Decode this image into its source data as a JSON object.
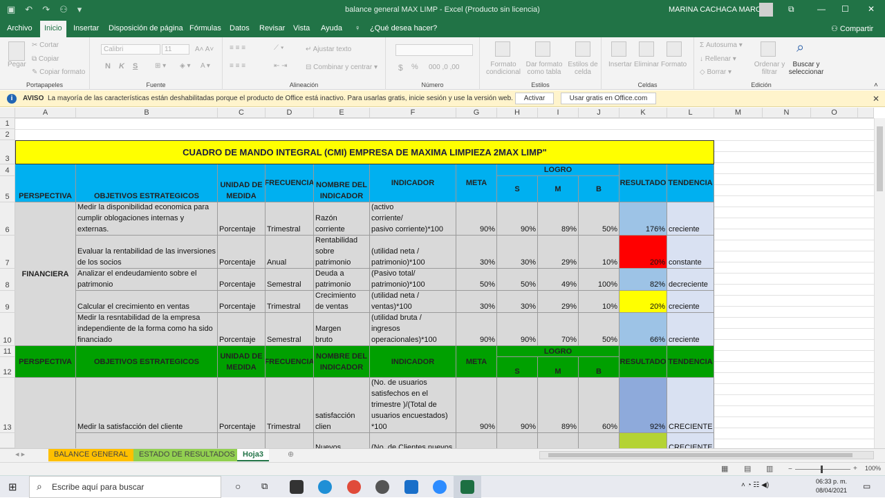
{
  "titlebar": {
    "doc_title": "balance general MAX LIMP  -  Excel (Producto sin licencia)",
    "user": "MARINA CACHACA MARCA",
    "qat_icons": [
      "save-icon",
      "undo-icon",
      "redo-icon",
      "share-user-icon",
      "qat-more-icon"
    ],
    "window_controls": [
      "restore-icon",
      "minimize-icon",
      "maximize-icon",
      "close-icon"
    ]
  },
  "tabs": [
    {
      "label": "Archivo"
    },
    {
      "label": "Inicio"
    },
    {
      "label": "Insertar"
    },
    {
      "label": "Disposición de página"
    },
    {
      "label": "Fórmulas"
    },
    {
      "label": "Datos"
    },
    {
      "label": "Revisar"
    },
    {
      "label": "Vista"
    },
    {
      "label": "Ayuda"
    }
  ],
  "tell_me": "¿Qué desea hacer?",
  "share_label": "Compartir",
  "ribbon": {
    "clipboard": {
      "paste": "Pegar",
      "cut": "Cortar",
      "copy": "Copiar",
      "format_painter": "Copiar formato",
      "group": "Portapapeles"
    },
    "font": {
      "name": "Calibri",
      "size": "11",
      "group": "Fuente",
      "bold": "N",
      "italic": "K",
      "underline": "S"
    },
    "alignment": {
      "wrap": "Ajustar texto",
      "merge": "Combinar y centrar",
      "group": "Alineación"
    },
    "number": {
      "group": "Número",
      "currency": "$",
      "percent": "%"
    },
    "styles": {
      "conditional": "Formato condicional",
      "table": "Dar formato como tabla",
      "cell_styles": "Estilos de celda",
      "group": "Estilos"
    },
    "cells": {
      "insert": "Insertar",
      "delete": "Eliminar",
      "format": "Formato",
      "group": "Celdas"
    },
    "editing": {
      "autosum": "Autosuma",
      "fill": "Rellenar",
      "clear": "Borrar",
      "sort": "Ordenar y filtrar",
      "find": "Buscar y seleccionar",
      "group": "Edición"
    }
  },
  "notice": {
    "label": "AVISO",
    "text": "La mayoría de las características están deshabilitadas porque el producto de Office está inactivo. Para usarlas gratis, inicie sesión y use la versión web.",
    "activate": "Activar",
    "web": "Usar gratis en Office.com"
  },
  "columns": [
    "A",
    "B",
    "C",
    "D",
    "E",
    "F",
    "G",
    "H",
    "I",
    "J",
    "K",
    "L",
    "M",
    "N",
    "O"
  ],
  "rows": [
    "1",
    "2",
    "3",
    "4",
    "5",
    "6",
    "7",
    "8",
    "9",
    "10",
    "11",
    "12",
    "13"
  ],
  "sheet": {
    "title": "CUADRO DE MANDO INTEGRAL (CMI) EMPRESA DE MAXIMA LIMPIEZA 2MAX LIMP\"",
    "headers": {
      "perspectiva": "PERSPECTIVA",
      "objetivos": "OBJETIVOS ESTRATEGICOS",
      "unidad": "UNIDAD DE MEDIDA",
      "frecuencia": "FRECUENCIA",
      "nombre": "NOMBRE DEL INDICADOR",
      "indicador": "INDICADOR",
      "meta": "META",
      "logro": "LOGRO",
      "s": "S",
      "m": "M",
      "b": "B",
      "resultado": "RESULTADO",
      "tendencia": "TENDENCIA"
    },
    "financiera_label": "FINANCIERA",
    "fin_rows": [
      {
        "obj": "Medir la disponibilidad economica para cumplir oblogaciones internas y externas.",
        "unidad": "Porcentaje",
        "frecuencia": "Trimestral",
        "nombre": "Razón corriente",
        "indicador": "(activo\ncorriente/\npasivo corriente)*100",
        "meta": "90%",
        "s": "90%",
        "m": "89%",
        "b": "50%",
        "resultado": "176%",
        "tendencia": "creciente",
        "color": "#9dc3e6"
      },
      {
        "obj": "Evaluar la rentabilidad de las inversiones de los socios",
        "unidad": "Porcentaje",
        "frecuencia": "Anual",
        "nombre": "Rentabilidad\nsobre\npatrimonio",
        "indicador": "(utilidad neta /\npatrimonio)*100",
        "meta": "30%",
        "s": "30%",
        "m": "29%",
        "b": "10%",
        "resultado": "20%",
        "tendencia": "constante",
        "color": "#ff0000"
      },
      {
        "obj": "Analizar el endeudamiento sobre el patrimonio",
        "unidad": "Porcentaje",
        "frecuencia": "Semestral",
        "nombre": "Deuda a\npatrimonio",
        "indicador": "(Pasivo total/\npatrimonio)*100",
        "meta": "50%",
        "s": "50%",
        "m": "49%",
        "b": "100%",
        "resultado": "82%",
        "tendencia": "decreciente",
        "color": "#9dc3e6"
      },
      {
        "obj": "Calcular el crecimiento en ventas",
        "unidad": "Porcentaje",
        "frecuencia": "Trimestral",
        "nombre": "Crecimiento\nde ventas",
        "indicador": "(utilidad neta /\nventas)*100",
        "meta": "30%",
        "s": "30%",
        "m": "29%",
        "b": "10%",
        "resultado": "20%",
        "tendencia": "creciente",
        "color": "#ffff00"
      },
      {
        "obj": "Medir la resntabilidad de la empresa independiente de la forma como ha sido financiado",
        "unidad": "Porcentaje",
        "frecuencia": "Semestral",
        "nombre": "Margen\nbruto",
        "indicador": "(utilidad bruta /\ningresos\noperacionales)*100",
        "meta": "90%",
        "s": "90%",
        "m": "70%",
        "b": "50%",
        "resultado": "66%",
        "tendencia": "creciente",
        "color": "#9dc3e6"
      }
    ],
    "cli_rows": [
      {
        "obj": "Medir la satisfacción del cliente",
        "unidad": "Porcentaje",
        "frecuencia": "Trimestral",
        "nombre": "satisfacción clien",
        "indicador": "(No. de usuarios\nsatisfechos en el\ntrimestre )/(Total de\nusuarios encuestados)\n*100",
        "meta": "90%",
        "s": "90%",
        "m": "89%",
        "b": "60%",
        "resultado": "92%",
        "tendencia": "CRECIENTE",
        "color": "#8eaadb"
      },
      {
        "obj": "",
        "unidad": "",
        "frecuencia": "",
        "nombre": "Nuevos",
        "indicador": "(No. de Clientes nuevos",
        "meta": "",
        "s": "",
        "m": "",
        "b": "",
        "resultado": "",
        "tendencia": "CRECIENTE",
        "color": "#b4d334"
      }
    ],
    "colors": {
      "title_bg": "#ffff00",
      "blue_header": "#00b0f0",
      "green_header": "#00a000",
      "body_bg": "#d9d9d9"
    }
  },
  "sheet_tabs": [
    {
      "label": "BALANCE GENERAL",
      "color": "#ffc000"
    },
    {
      "label": "ESTADO DE RESULTADOS",
      "color": "#92d050"
    },
    {
      "label": "Hoja3",
      "color": "#ffffff"
    }
  ],
  "status": {
    "zoom": "100%"
  },
  "taskbar": {
    "search": "Escribe aquí para buscar",
    "time": "06:33 p. m.",
    "date": "08/04/2021"
  }
}
